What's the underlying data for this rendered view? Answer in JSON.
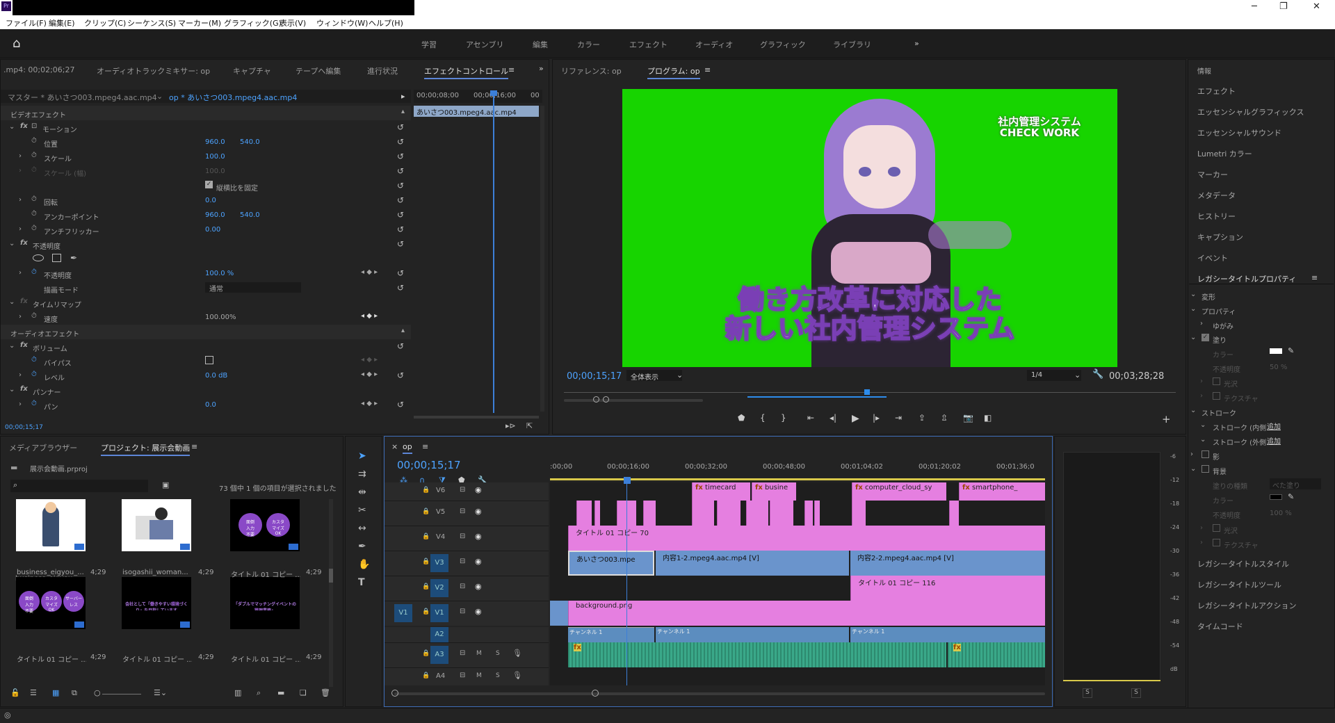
{
  "app": {
    "icon": "Pr"
  },
  "menu": [
    "ファイル(F)",
    "編集(E)",
    "クリップ(C)",
    "シーケンス(S)",
    "マーカー(M)",
    "グラフィック(G)",
    "表示(V)",
    "ウィンドウ(W)",
    "ヘルプ(H)"
  ],
  "workspaces": [
    "学習",
    "アセンブリ",
    "編集",
    "カラー",
    "エフェクト",
    "オーディオ",
    "グラフィック",
    "ライブラリ"
  ],
  "effect_panel": {
    "tabs": [
      ".mp4: 00;02;06;27",
      "オーディオトラックミキサー: op",
      "キャプチャ",
      "テープへ編集",
      "進行状況",
      "エフェクトコントロール"
    ],
    "master": "マスター * あいさつ003.mpeg4.aac.mp4",
    "seq": "op * あいさつ003.mpeg4.aac.mp4",
    "time1": "00;00;08;00",
    "time2": "00;00;16;00",
    "time3": "00",
    "clip": "あいさつ003.mpeg4.aac.mp4",
    "video_fx": "ビデオエフェクト",
    "motion": "モーション",
    "position": "位置",
    "pos_x": "960.0",
    "pos_y": "540.0",
    "scale": "スケール",
    "scale_v": "100.0",
    "scale_w": "スケール (幅)",
    "scale_w_v": "100.0",
    "uniform": "縦横比を固定",
    "rotation": "回転",
    "rot_v": "0.0",
    "anchor": "アンカーポイント",
    "anc_x": "960.0",
    "anc_y": "540.0",
    "flicker": "アンチフリッカー",
    "flicker_v": "0.00",
    "opacity": "不透明度",
    "opacity_p": "不透明度",
    "opacity_v": "100.0 %",
    "blend": "描画モード",
    "blend_v": "通常",
    "timeremap": "タイムリマップ",
    "speed": "速度",
    "speed_v": "100.00%",
    "audio_fx": "オーディオエフェクト",
    "volume": "ボリューム",
    "bypass": "バイパス",
    "level": "レベル",
    "level_v": "0.0 dB",
    "panner": "パンナー",
    "pan": "パン",
    "pan_v": "0.0",
    "timecode": "00;00;15;17"
  },
  "program": {
    "tabs": [
      "リファレンス: op",
      "プログラム: op"
    ],
    "overlay_title1": "社内管理システム",
    "overlay_title2": "CHECK WORK",
    "caption1": "働き方改革に対応した",
    "caption2": "新しい社内管理システム",
    "timecode": "00;00;15;17",
    "fit": "全体表示",
    "res": "1/4",
    "duration": "00;03;28;28"
  },
  "right_panel": {
    "items": [
      "情報",
      "エフェクト",
      "エッセンシャルグラフィックス",
      "エッセンシャルサウンド",
      "Lumetri カラー",
      "マーカー",
      "メタデータ",
      "ヒストリー",
      "キャプション",
      "イベント",
      "レガシータイトルプロパティ"
    ],
    "transform": "変形",
    "properties": "プロパティ",
    "distort": "ゆがみ",
    "fill": "塗り",
    "color": "カラー",
    "opacity": "不透明度",
    "opacity_v": "50 %",
    "sheen": "光沢",
    "texture": "テクスチャ",
    "stroke": "ストローク",
    "stroke_in": "ストローク (内側)",
    "stroke_out": "ストローク (外側)",
    "add": "追加",
    "shadow": "影",
    "background": "背景",
    "fill_type": "塗りの種類",
    "fill_type_v": "べた塗り",
    "opacity2_v": "100 %",
    "bottom": [
      "レガシータイトルスタイル",
      "レガシータイトルツール",
      "レガシータイトルアクション",
      "タイムコード"
    ]
  },
  "project": {
    "tabs": [
      "メディアブラウザー",
      "プロジェクト: 展示会動画"
    ],
    "file": "展示会動画.prproj",
    "count": "73 個中 1 個の項目が選択されました",
    "items": [
      {
        "name": "business_eigyou_...",
        "dur": "4;29"
      },
      {
        "name": "isogashii_woman...",
        "dur": "4;29"
      },
      {
        "name": "タイトル 01 コピー ...",
        "dur": "4;29"
      },
      {
        "name": "タイトル 01 コピー ...",
        "dur": "4;29"
      },
      {
        "name": "タイトル 01 コピー ...",
        "dur": "4;29"
      },
      {
        "name": "タイトル 01 コピー ...",
        "dur": "4;29"
      }
    ],
    "circle1": "面倒\n入力\n不要",
    "circle2": "カスタ\nマイズ\nOK",
    "circle3": "カスタ\nマイズ\nOK",
    "circle4": "サーバー\nレス",
    "thumb5": "会社として「働きやすい環境づくり」を目指しています",
    "thumb6": "「ダブルでマッチングイベントの管理業務」"
  },
  "timeline": {
    "tab": "op",
    "timecode": "00;00;15;17",
    "ruler": [
      ":00;00",
      "00;00;16;00",
      "00;00;32;00",
      "00;00;48;00",
      "00;01;04;02",
      "00;01;20;02",
      "00;01;36;0"
    ],
    "tracks": [
      "V6",
      "V5",
      "V4",
      "V3",
      "V2",
      "V1",
      "A2",
      "A3",
      "A4"
    ],
    "clips": {
      "v6a": "timecard",
      "v6b": "busine",
      "v6c": "computer_cloud_sy",
      "v6d": "smartphone_",
      "v4": "タイトル 01 コピー 70",
      "v3a": "あいさつ003.mpe",
      "v3b": "内容1-2.mpeg4.aac.mp4 [V]",
      "v3c": "内容2-2.mpeg4.aac.mp4 [V]",
      "v2": "タイトル 01 コピー 116",
      "v1": "background.png",
      "a2a": "チャンネル 1",
      "a2b": "チャンネル 1",
      "a2c": "チャンネル 1"
    },
    "audio_labels": {
      "m": "M",
      "s": "S"
    }
  },
  "meter": {
    "scale": [
      "-6",
      "-12",
      "-18",
      "-24",
      "-30",
      "-36",
      "-42",
      "-48",
      "-54",
      "dB"
    ],
    "solo": [
      "S",
      "S"
    ]
  },
  "colors": {
    "green": "#17d400",
    "pink": "#e57fe0",
    "clipblue": "#6a94cc",
    "accent": "#2d8ceb"
  }
}
